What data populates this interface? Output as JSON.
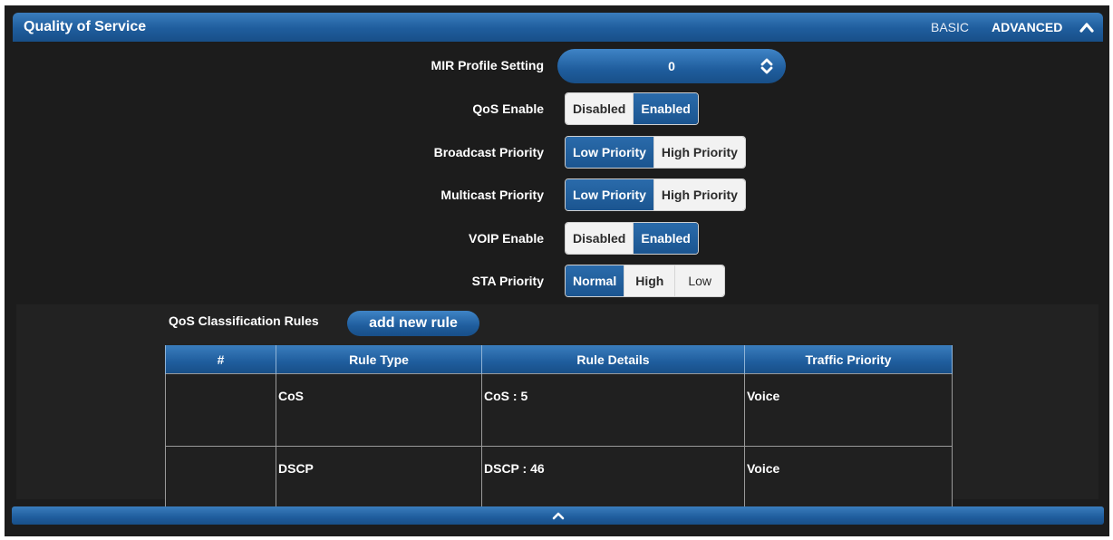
{
  "header": {
    "title": "Quality of Service",
    "mode_basic": "BASIC",
    "mode_advanced": "ADVANCED",
    "collapse_icon": "chevron-up-icon"
  },
  "settings": {
    "mir_profile": {
      "label": "MIR Profile Setting",
      "value": "0"
    },
    "qos_enable": {
      "label": "QoS Enable",
      "options": [
        "Disabled",
        "Enabled"
      ],
      "selected": "Enabled"
    },
    "broadcast_priority": {
      "label": "Broadcast Priority",
      "options": [
        "Low Priority",
        "High Priority"
      ],
      "selected": "Low Priority"
    },
    "multicast_priority": {
      "label": "Multicast Priority",
      "options": [
        "Low Priority",
        "High Priority"
      ],
      "selected": "Low Priority"
    },
    "voip_enable": {
      "label": "VOIP Enable",
      "options": [
        "Disabled",
        "Enabled"
      ],
      "selected": "Enabled"
    },
    "sta_priority": {
      "label": "STA Priority",
      "options": [
        "Normal",
        "High",
        "Low"
      ],
      "selected": "Normal"
    }
  },
  "rules": {
    "title": "QoS Classification Rules",
    "add_button": "add new rule",
    "columns": [
      "#",
      "Rule Type",
      "Rule Details",
      "Traffic Priority"
    ],
    "rows": [
      [
        "",
        "CoS",
        "CoS : 5",
        "Voice"
      ],
      [
        "",
        "DSCP",
        "DSCP : 46",
        "Voice"
      ]
    ]
  },
  "colors": {
    "accent": "#1f5d9d",
    "background": "#1c1c1c",
    "toggle_inactive": "#f2f2f2"
  }
}
